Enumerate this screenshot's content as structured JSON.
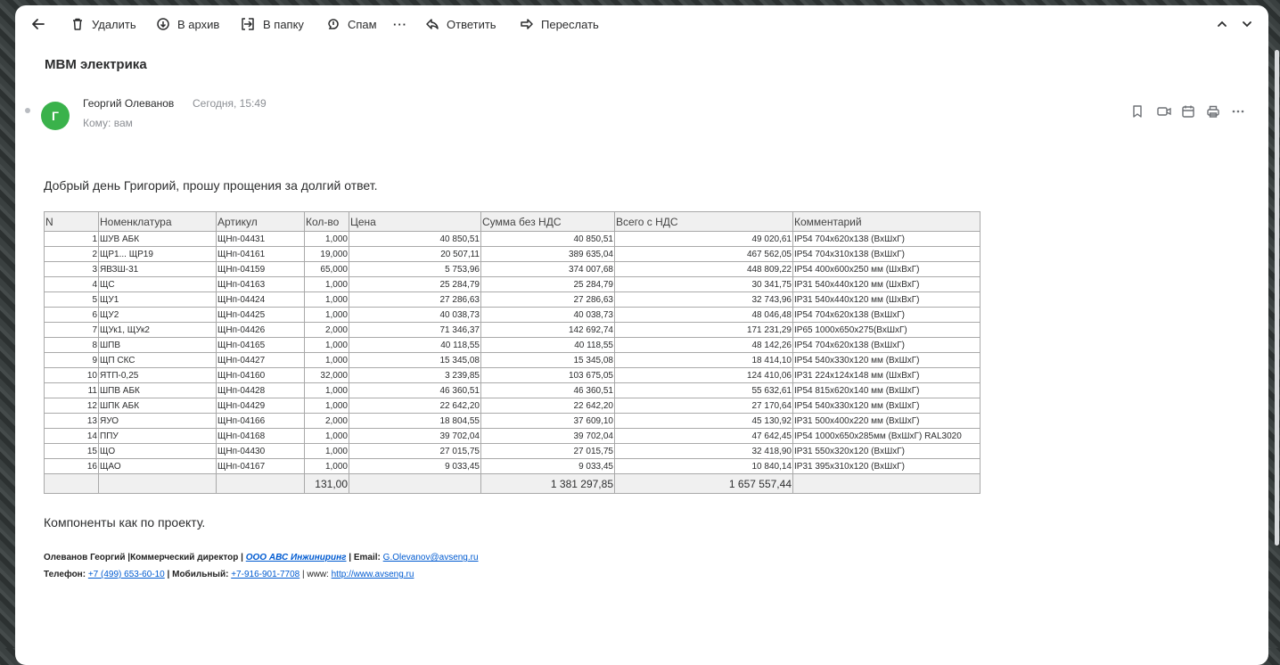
{
  "toolbar": {
    "delete": "Удалить",
    "archive": "В архив",
    "folder": "В папку",
    "spam": "Спам",
    "more": "···",
    "reply": "Ответить",
    "forward": "Переслать"
  },
  "email": {
    "subject": "MBM электрика",
    "avatar_letter": "Г",
    "sender": "Георгий Олеванов",
    "date": "Сегодня, 15:49",
    "to": "Кому: вам",
    "greeting": "Добрый день Григорий, прошу прощения за долгий ответ.",
    "components": "Компоненты как по проекту."
  },
  "table": {
    "headers": [
      "N",
      "Номенклатура",
      "Артикул",
      "Кол-во",
      "Цена",
      "Сумма без НДС",
      "Всего с НДС",
      "Комментарий"
    ],
    "rows": [
      [
        "1",
        "ШУВ АБК",
        "ЩНп-04431",
        "1,000",
        "40 850,51",
        "40 850,51",
        "49 020,61",
        "IP54 704x620x138 (ВхШхГ)"
      ],
      [
        "2",
        "ЩР1... ЩР19",
        "ЩНп-04161",
        "19,000",
        "20 507,11",
        "389 635,04",
        "467 562,05",
        "IP54 704x310x138 (ВхШхГ)"
      ],
      [
        "3",
        "ЯВЗШ-31",
        "ЩНп-04159",
        "65,000",
        "5 753,96",
        "374 007,68",
        "448 809,22",
        "IP54  400x600x250 мм (ШхВхГ)"
      ],
      [
        "4",
        "ЩС",
        "ЩНп-04163",
        "1,000",
        "25 284,79",
        "25 284,79",
        "30 341,75",
        "IP31 540x440x120 мм (ШхВхГ)"
      ],
      [
        "5",
        "ЩУ1",
        "ЩНп-04424",
        "1,000",
        "27 286,63",
        "27 286,63",
        "32 743,96",
        "IP31 540x440x120 мм (ШхВхГ)"
      ],
      [
        "6",
        "ЩУ2",
        "ЩНп-04425",
        "1,000",
        "40 038,73",
        "40 038,73",
        "48 046,48",
        "IP54 704x620x138 (ВхШхГ)"
      ],
      [
        "7",
        "ЩУк1, ЩУк2",
        "ЩНп-04426",
        "2,000",
        "71 346,37",
        "142 692,74",
        "171 231,29",
        "IP65 1000x650x275(ВхШхГ)"
      ],
      [
        "8",
        "ШПВ",
        "ЩНп-04165",
        "1,000",
        "40 118,55",
        "40 118,55",
        "48 142,26",
        "IP54 704x620x138 (ВхШхГ)"
      ],
      [
        "9",
        "ЩП СКС",
        "ЩНп-04427",
        "1,000",
        "15 345,08",
        "15 345,08",
        "18 414,10",
        "IP54  540x330x120 мм (ВхШхГ)"
      ],
      [
        "10",
        "ЯТП-0,25",
        "ЩНп-04160",
        "32,000",
        "3 239,85",
        "103 675,05",
        "124 410,06",
        "IP31 224x124x148 мм (ШхВхГ)"
      ],
      [
        "11",
        "ШПВ АБК",
        "ЩНп-04428",
        "1,000",
        "46 360,51",
        "46 360,51",
        "55 632,61",
        "IP54  815x620x140 мм (ВхШхГ)"
      ],
      [
        "12",
        "ШПК АБК",
        "ЩНп-04429",
        "1,000",
        "22 642,20",
        "22 642,20",
        "27 170,64",
        "IP54  540x330x120 мм (ВхШхГ)"
      ],
      [
        "13",
        "ЯУО",
        "ЩНп-04166",
        "2,000",
        "18 804,55",
        "37 609,10",
        "45 130,92",
        "IP31 500x400x220 мм   (ВхШхГ)"
      ],
      [
        "14",
        "ППУ",
        "ЩНп-04168",
        "1,000",
        "39 702,04",
        "39 702,04",
        "47 642,45",
        "IP54 1000x650x285мм (ВхШхГ)   RAL3020"
      ],
      [
        "15",
        "ЩО",
        "ЩНп-04430",
        "1,000",
        "27 015,75",
        "27 015,75",
        "32 418,90",
        "IP31 550x320x120 (ВхШхГ)"
      ],
      [
        "16",
        "ЩАО",
        "ЩНп-04167",
        "1,000",
        "9 033,45",
        "9 033,45",
        "10 840,14",
        "IP31 395x310x120 (ВхШхГ)"
      ]
    ],
    "totals": [
      "",
      "",
      "",
      "131,00",
      "",
      "1 381 297,85",
      "1 657 557,44",
      ""
    ]
  },
  "signature": {
    "name": "Олеванов Георгий",
    "position": "|Коммерческий директор |",
    "company": "ООО АВС Инжиниринг",
    "email_label": "| Email:",
    "email": "G.Olevanov@avseng.ru",
    "phone_label": "Телефон:",
    "phone": "+7 (499) 653-60-10",
    "mobile_label": "| Мобильный:",
    "mobile": "+7-916-901-7708",
    "www_label": "| www:",
    "www": "http://www.avseng.ru"
  },
  "colors": {
    "avatar": "#3ab24b",
    "link": "#005bd1"
  }
}
